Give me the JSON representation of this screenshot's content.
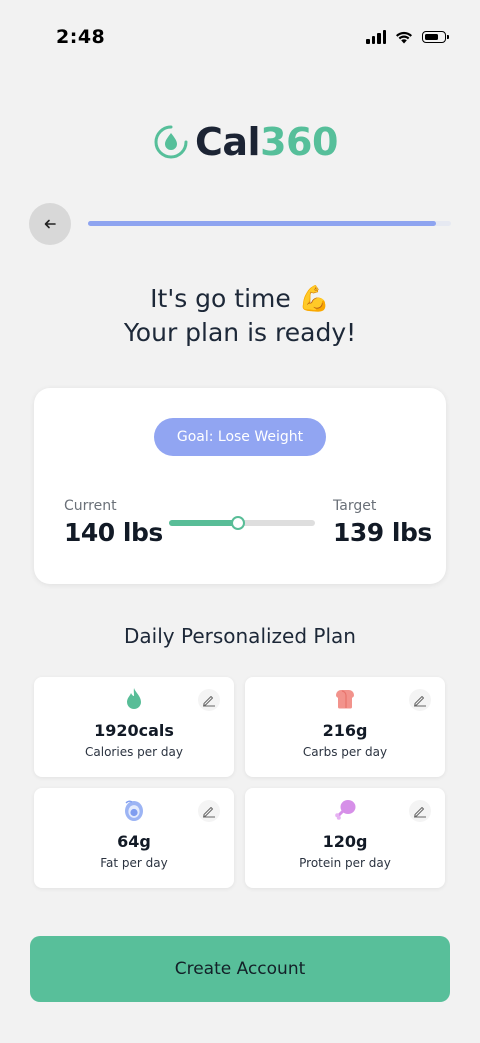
{
  "status_bar": {
    "time": "2:48"
  },
  "app": {
    "logo_part1": "Cal",
    "logo_part2": "360",
    "brand_color": "#56bf9a"
  },
  "progress": {
    "fraction": 0.96,
    "color": "#8ea4f0"
  },
  "headline": {
    "line1": "It's go time 💪",
    "line2": "Your plan is ready!"
  },
  "goal_card": {
    "goal_label": "Goal:  Lose Weight",
    "current_label": "Current",
    "current_value": "140 lbs",
    "target_label": "Target",
    "target_value": "139 lbs",
    "slider_fraction": 0.47
  },
  "plan": {
    "title": "Daily Personalized Plan",
    "items": [
      {
        "icon": "flame-icon",
        "value": "1920cals",
        "label": "Calories per day",
        "color": "#58bd97"
      },
      {
        "icon": "bread-icon",
        "value": "216g",
        "label": "Carbs per day",
        "color": "#f2938c"
      },
      {
        "icon": "avocado-icon",
        "value": "64g",
        "label": "Fat per day",
        "color": "#7f9df0"
      },
      {
        "icon": "drumstick-icon",
        "value": "120g",
        "label": "Protein per day",
        "color": "#d68fe8"
      }
    ]
  },
  "cta": {
    "label": "Create Account"
  }
}
